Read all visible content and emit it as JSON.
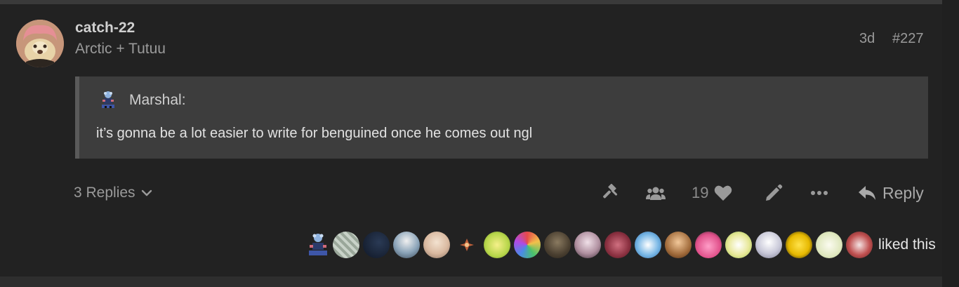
{
  "post": {
    "username": "catch-22",
    "user_title": "Arctic + Tutuu",
    "date": "3d",
    "number": "#227",
    "avatar_icon": "user-avatar-icon"
  },
  "quote": {
    "author": "Marshal:",
    "text": "it’s gonna be a lot easier to write for benguined once he comes out ngl"
  },
  "actions": {
    "replies_label": "3 Replies",
    "like_count": "19",
    "reply_label": "Reply",
    "icons": [
      "gavel-icon",
      "group-icon",
      "heart-icon",
      "edit-pencil-icon",
      "more-ellipsis-icon",
      "reply-arrow-icon"
    ]
  },
  "likes": {
    "label": "liked this",
    "liker_count": 19
  },
  "colors": {
    "background": "#222222",
    "quote_background": "#3d3d3d",
    "muted_text": "#9a9a9a"
  }
}
